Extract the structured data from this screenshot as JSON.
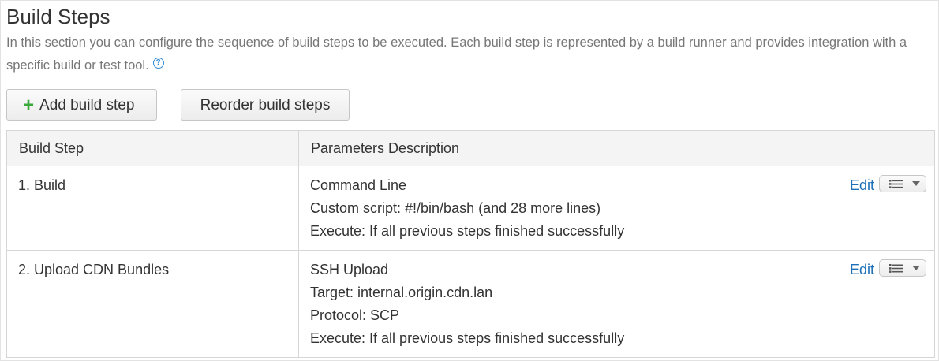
{
  "section": {
    "title": "Build Steps",
    "description": "In this section you can configure the sequence of build steps to be executed. Each build step is represented by a build runner and provides integration with a specific build or test tool.",
    "help_icon": "question-circle-icon"
  },
  "toolbar": {
    "add_label": "Add build step",
    "add_icon": "plus-icon",
    "reorder_label": "Reorder build steps"
  },
  "table": {
    "headers": [
      "Build Step",
      "Parameters Description"
    ],
    "rows": [
      {
        "step": "1. Build",
        "lines": [
          "Command Line",
          "Custom script: #!/bin/bash (and 28 more lines)",
          "Execute: If all previous steps finished successfully"
        ],
        "edit_label": "Edit",
        "menu_icon": "list-icon"
      },
      {
        "step": "2. Upload CDN Bundles",
        "lines": [
          "SSH Upload",
          "Target: internal.origin.cdn.lan",
          "Protocol: SCP",
          "Execute: If all previous steps finished successfully"
        ],
        "edit_label": "Edit",
        "menu_icon": "list-icon"
      }
    ]
  },
  "colors": {
    "link": "#1d6fb8",
    "add_icon": "#3aa83a",
    "help_icon": "#2f8bd9"
  }
}
